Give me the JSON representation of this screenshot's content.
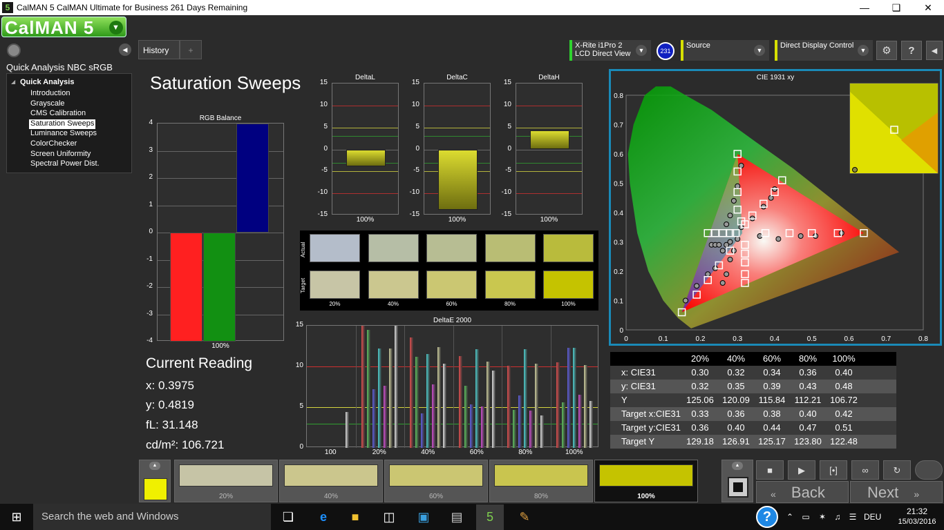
{
  "window": {
    "title": "CalMAN 5 CalMAN Ultimate for Business 261 Days Remaining",
    "logo_text": "5"
  },
  "app": {
    "logo": "CalMAN 5"
  },
  "sidebar": {
    "workflow_title": "Quick Analysis NBC sRGB",
    "group": "Quick Analysis",
    "items": [
      "Introduction",
      "Grayscale",
      "CMS Calibration",
      "Saturation Sweeps",
      "Luminance Sweeps",
      "ColorChecker",
      "Screen Uniformity",
      "Spectral Power Dist."
    ],
    "selected_index": 3
  },
  "tabs": [
    {
      "label": "History 1"
    },
    {
      "label": "+"
    }
  ],
  "devices": {
    "meter": {
      "line1": "X-Rite i1Pro 2",
      "line2": "LCD Direct View",
      "badge": "231"
    },
    "source": {
      "label": "Source"
    },
    "display": {
      "label": "Direct Display Control"
    }
  },
  "page": {
    "title": "Saturation Sweeps"
  },
  "rgb_balance": {
    "title": "RGB Balance",
    "ticks": [
      "4",
      "3",
      "2",
      "1",
      "0",
      "-1",
      "-2",
      "-3",
      "-4"
    ],
    "xlabel": "100%",
    "chart_data": {
      "type": "bar",
      "categories": [
        "R",
        "G",
        "B"
      ],
      "values": [
        -4.0,
        -4.0,
        4.0
      ],
      "ylim": [
        -4,
        4
      ],
      "colors": [
        "#ff2020",
        "#129012",
        "#000080"
      ]
    }
  },
  "delta_charts": [
    {
      "title": "DeltaL",
      "xlabel": "100%",
      "chart_data": {
        "type": "bar",
        "categories": [
          "100%"
        ],
        "values": [
          -3.8
        ],
        "ylim": [
          -15,
          15
        ]
      }
    },
    {
      "title": "DeltaC",
      "xlabel": "100%",
      "chart_data": {
        "type": "bar",
        "categories": [
          "100%"
        ],
        "values": [
          -13.7
        ],
        "ylim": [
          -15,
          15
        ]
      }
    },
    {
      "title": "DeltaH",
      "xlabel": "100%",
      "chart_data": {
        "type": "bar",
        "categories": [
          "100%"
        ],
        "values": [
          4.3
        ],
        "ylim": [
          -15,
          15
        ]
      }
    }
  ],
  "delta_ticks": [
    "15",
    "10",
    "5",
    "0",
    "-5",
    "-10",
    "-15"
  ],
  "swatches": {
    "actual_label": "Actual",
    "target_label": "Target",
    "labels": [
      "20%",
      "40%",
      "60%",
      "80%",
      "100%"
    ],
    "actual": [
      "#b4bdca",
      "#b6bea6",
      "#b7bd93",
      "#b9bd74",
      "#b9bb3c"
    ],
    "target": [
      "#c7c5a6",
      "#cbc78f",
      "#cbc772",
      "#c9c74f",
      "#c5c300"
    ]
  },
  "deltae": {
    "title": "DeltaE 2000",
    "ticks": [
      "15",
      "10",
      "5",
      "0"
    ],
    "groups": [
      "100",
      "20%",
      "40%",
      "60%",
      "80%",
      "100%"
    ],
    "chart_data": {
      "type": "bar",
      "ylim": [
        0,
        15
      ],
      "categories": [
        "100",
        "20%",
        "40%",
        "60%",
        "80%",
        "100%"
      ],
      "series": [
        {
          "values": [
            0,
            15.0,
            13.6,
            11.3,
            10.1,
            10.5
          ],
          "color": "#e05050"
        },
        {
          "values": [
            0,
            14.5,
            11.2,
            7.6,
            4.7,
            5.6
          ],
          "color": "#60c060"
        },
        {
          "values": [
            0,
            7.2,
            4.2,
            5.3,
            6.4,
            12.3
          ],
          "color": "#6060e0"
        },
        {
          "values": [
            0,
            12.2,
            11.5,
            12.1,
            12.1,
            12.3
          ],
          "color": "#50d0d0"
        },
        {
          "values": [
            0,
            7.6,
            7.8,
            5.1,
            4.6,
            6.5
          ],
          "color": "#d050d0"
        },
        {
          "values": [
            0,
            12.2,
            12.4,
            10.6,
            10.3,
            10.2
          ],
          "color": "#d0d0a0"
        },
        {
          "values": [
            4.4,
            15.0,
            10.3,
            9.5,
            4.0,
            5.8
          ],
          "color": "#e0e0e0"
        }
      ]
    }
  },
  "current_reading": {
    "title": "Current Reading",
    "x": "x: 0.3975",
    "y": "y: 0.4819",
    "fl": "fL: 31.148",
    "cdm2": "cd/m²: 106.721"
  },
  "cie": {
    "title": "CIE 1931 xy",
    "xticks": [
      "0",
      "0.1",
      "0.2",
      "0.3",
      "0.4",
      "0.5",
      "0.6",
      "0.7",
      "0.8"
    ],
    "yticks": [
      "0.8",
      "0.7",
      "0.6",
      "0.5",
      "0.4",
      "0.3",
      "0.2",
      "0.1",
      "0"
    ],
    "chart_data": {
      "type": "scatter",
      "xlim": [
        0,
        0.8
      ],
      "ylim": [
        0,
        0.8
      ],
      "gamut": [
        [
          0.64,
          0.33
        ],
        [
          0.3,
          0.6
        ],
        [
          0.15,
          0.06
        ]
      ],
      "white": [
        0.3127,
        0.329
      ],
      "targets": [
        [
          0.64,
          0.33
        ],
        [
          0.57,
          0.33
        ],
        [
          0.5,
          0.33
        ],
        [
          0.44,
          0.33
        ],
        [
          0.375,
          0.33
        ],
        [
          0.3,
          0.6
        ],
        [
          0.3,
          0.54
        ],
        [
          0.3,
          0.47
        ],
        [
          0.3,
          0.41
        ],
        [
          0.31,
          0.37
        ],
        [
          0.15,
          0.06
        ],
        [
          0.19,
          0.12
        ],
        [
          0.22,
          0.17
        ],
        [
          0.25,
          0.22
        ],
        [
          0.28,
          0.27
        ],
        [
          0.42,
          0.51
        ],
        [
          0.4,
          0.47
        ],
        [
          0.37,
          0.43
        ],
        [
          0.34,
          0.39
        ],
        [
          0.32,
          0.36
        ],
        [
          0.22,
          0.33
        ],
        [
          0.24,
          0.33
        ],
        [
          0.26,
          0.33
        ],
        [
          0.28,
          0.33
        ],
        [
          0.295,
          0.33
        ],
        [
          0.32,
          0.16
        ],
        [
          0.32,
          0.19
        ],
        [
          0.32,
          0.23
        ],
        [
          0.32,
          0.26
        ],
        [
          0.32,
          0.29
        ]
      ],
      "actuals": [
        [
          0.58,
          0.33
        ],
        [
          0.51,
          0.32
        ],
        [
          0.47,
          0.32
        ],
        [
          0.41,
          0.31
        ],
        [
          0.36,
          0.32
        ],
        [
          0.31,
          0.56
        ],
        [
          0.3,
          0.49
        ],
        [
          0.29,
          0.44
        ],
        [
          0.28,
          0.39
        ],
        [
          0.27,
          0.36
        ],
        [
          0.16,
          0.1
        ],
        [
          0.19,
          0.15
        ],
        [
          0.22,
          0.19
        ],
        [
          0.24,
          0.21
        ],
        [
          0.26,
          0.27
        ],
        [
          0.4,
          0.48
        ],
        [
          0.39,
          0.45
        ],
        [
          0.37,
          0.42
        ],
        [
          0.34,
          0.38
        ],
        [
          0.31,
          0.35
        ],
        [
          0.23,
          0.29
        ],
        [
          0.24,
          0.29
        ],
        [
          0.25,
          0.29
        ],
        [
          0.27,
          0.29
        ],
        [
          0.28,
          0.3
        ],
        [
          0.26,
          0.16
        ],
        [
          0.27,
          0.19
        ],
        [
          0.28,
          0.24
        ],
        [
          0.29,
          0.27
        ],
        [
          0.3,
          0.31
        ]
      ]
    }
  },
  "table": {
    "headers": [
      "20%",
      "40%",
      "60%",
      "80%",
      "100%"
    ],
    "rows": [
      {
        "label": "x: CIE31",
        "values": [
          "0.30",
          "0.32",
          "0.34",
          "0.36",
          "0.40"
        ]
      },
      {
        "label": "y: CIE31",
        "values": [
          "0.32",
          "0.35",
          "0.39",
          "0.43",
          "0.48"
        ]
      },
      {
        "label": "Y",
        "values": [
          "125.06",
          "120.09",
          "115.84",
          "112.21",
          "106.72"
        ]
      },
      {
        "label": "Target x:CIE31",
        "values": [
          "0.33",
          "0.36",
          "0.38",
          "0.40",
          "0.42"
        ]
      },
      {
        "label": "Target y:CIE31",
        "values": [
          "0.36",
          "0.40",
          "0.44",
          "0.47",
          "0.51"
        ]
      },
      {
        "label": "Target Y",
        "values": [
          "129.18",
          "126.91",
          "125.17",
          "123.80",
          "122.48"
        ]
      }
    ]
  },
  "bottom": {
    "current_color": "#f0f000",
    "patches": [
      {
        "label": "20%",
        "color": "#c6c4a6"
      },
      {
        "label": "40%",
        "color": "#cbc68d"
      },
      {
        "label": "60%",
        "color": "#cbc672"
      },
      {
        "label": "80%",
        "color": "#c9c54f"
      },
      {
        "label": "100%",
        "color": "#c5c300"
      }
    ],
    "back_label": "Back",
    "next_label": "Next"
  },
  "taskbar": {
    "search_placeholder": "Search the web and Windows",
    "lang": "DEU",
    "time": "21:32",
    "date": "15/03/2016"
  }
}
